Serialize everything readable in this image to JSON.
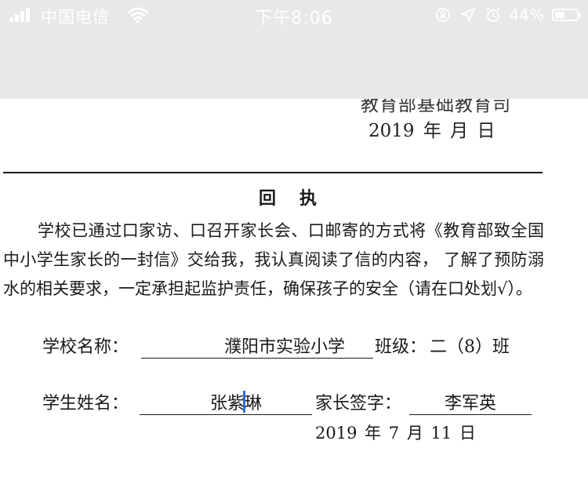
{
  "status_bar": {
    "carrier": "中国电信",
    "time": "下午8:06",
    "battery_percent": "44%",
    "icons": [
      "signal-icon",
      "wifi-icon",
      "screen-lock-icon",
      "location-icon",
      "alarm-icon",
      "battery-icon"
    ],
    "bar_color": "#e8e8e8"
  },
  "document": {
    "sender_partial": "教育部基础教育司",
    "date_blank": "2019 年    月    日",
    "heading": "回执",
    "paragraph": {
      "line1": "学校已通过口家访、口召开家长会、口邮寄的方式将《教育部致全国中小学生家长的一封信》交给我，我认真阅读了信的内容，  了解了预防溺水的相关要求，一定承担起监护责任，确保孩子的安全（请在口处划√）。"
    },
    "fields": {
      "school_label": "学校名称：",
      "school_value": "濮阳市实验小学",
      "class_label": "班级：",
      "class_value": "二（8）班",
      "student_label": "学生姓名：",
      "student_value": "张紫琳",
      "parent_label": "家长签字：",
      "parent_value": "李军英"
    },
    "sign_date": "2019 年 7 月  11 日"
  }
}
